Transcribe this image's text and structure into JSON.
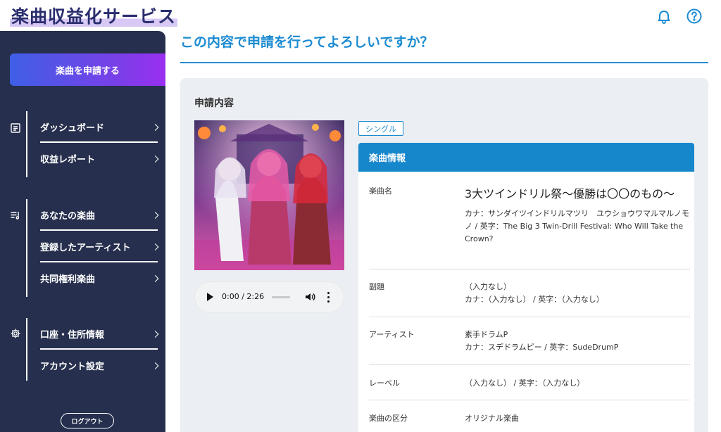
{
  "app": {
    "logo": "楽曲収益化サービス"
  },
  "header": {
    "icons": [
      "bell-icon",
      "help-icon"
    ]
  },
  "sidebar": {
    "apply_button": "楽曲を申請する",
    "groups": [
      {
        "icon": "document-icon",
        "items": [
          "ダッシュボード",
          "収益レポート"
        ]
      },
      {
        "icon": "music-list-icon",
        "items": [
          "あなたの楽曲",
          "登録したアーティスト",
          "共同権利楽曲"
        ]
      },
      {
        "icon": "gear-icon",
        "items": [
          "口座・住所情報",
          "アカウント設定"
        ]
      }
    ],
    "logout": "ログアウト"
  },
  "main": {
    "title": "この内容で申請を行ってよろしいですか？",
    "panel_title": "申請内容",
    "audio": {
      "time": "0:00 / 2:26"
    },
    "badge": "シングル",
    "info_header": "楽曲情報",
    "rows": [
      {
        "label": "楽曲名",
        "title": "3大ツインドリル祭～優勝は〇〇のもの～",
        "lines": [
          "カナ：サンダイツインドリルマツリ　ユウショウワマルマルノモノ / 英字：The Big 3 Twin-Drill Festival: Who Will Take the Crown?"
        ]
      },
      {
        "label": "副題",
        "lines": [
          "（入力なし）",
          "カナ：（入力なし） / 英字：（入力なし）"
        ]
      },
      {
        "label": "アーティスト",
        "lines": [
          "素手ドラムP",
          "カナ：スデドラムピー / 英字：SudeDrumP"
        ]
      },
      {
        "label": "レーベル",
        "lines": [
          "（入力なし） / 英字：（入力なし）"
        ]
      },
      {
        "label": "楽曲の区分",
        "lines": [
          "オリジナル楽曲"
        ]
      }
    ]
  },
  "colors": {
    "accent": "#1a8ad1",
    "sidebar": "#262f4d",
    "header_bar": "#1787cc",
    "panel": "#ebeef2"
  }
}
